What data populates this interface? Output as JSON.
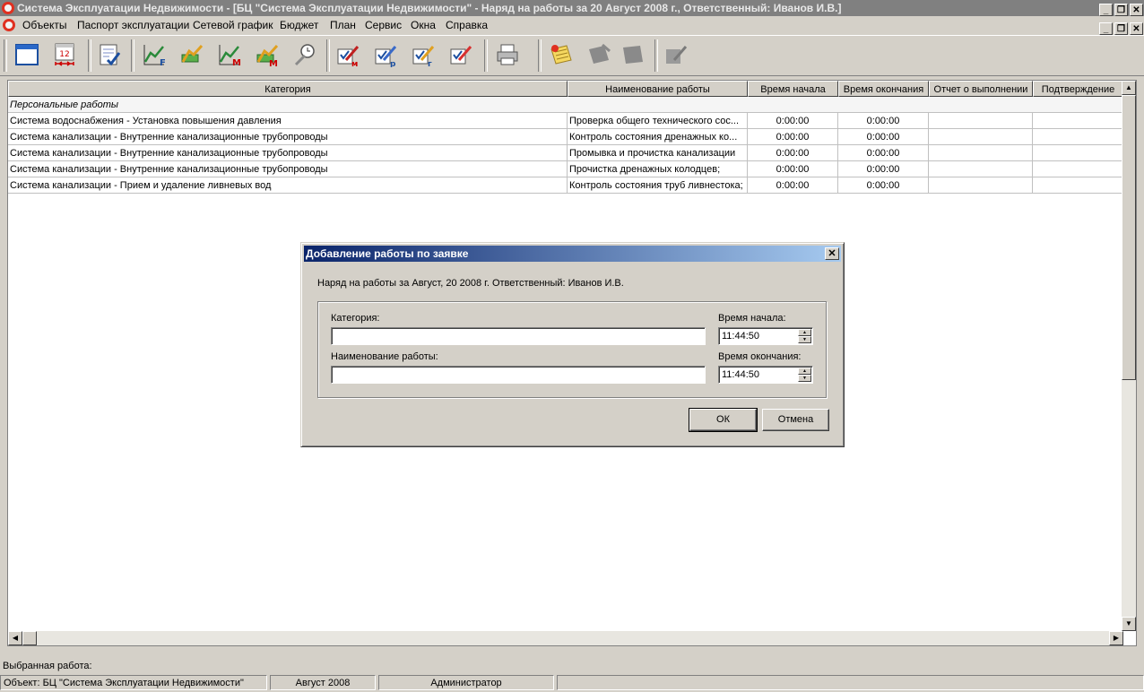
{
  "window": {
    "title": "Система Эксплуатации Недвижимости - [БЦ \"Система Эксплуатации Недвижимости\" - Наряд на работы за 20 Август 2008 г., Ответственный: Иванов И.В.]"
  },
  "menu": [
    "Объекты",
    "Паспорт эксплуатации",
    "Сетевой график",
    "Бюджет",
    "План",
    "Сервис",
    "Окна",
    "Справка"
  ],
  "toolbar": {
    "icons": [
      "window-icon",
      "calendar-icon",
      "document-check-icon",
      "chart-f-icon",
      "chart-money-icon",
      "chart-m-icon",
      "chart-money-m-icon",
      "clock-tools-icon",
      "edit-m-icon",
      "edit-p-icon",
      "edit-g-icon",
      "edit-red-icon",
      "printer-icon",
      "note-star-icon",
      "disabled-icon-1",
      "disabled-icon-2",
      "disabled-check-icon"
    ]
  },
  "grid": {
    "columns": [
      "Категория",
      "Наименование работы",
      "Время начала",
      "Время окончания",
      "Отчет о выполнении",
      "Подтверждение"
    ],
    "group_label": "Персональные работы",
    "rows": [
      {
        "category": "Система водоснабжения - Установка повышения давления",
        "work": "Проверка общего технического сос...",
        "start": "0:00:00",
        "end": "0:00:00",
        "report": "",
        "confirm": ""
      },
      {
        "category": "Система канализации - Внутренние канализационные трубопроводы",
        "work": "Контроль состояния дренажных ко...",
        "start": "0:00:00",
        "end": "0:00:00",
        "report": "",
        "confirm": ""
      },
      {
        "category": "Система канализации - Внутренние канализационные трубопроводы",
        "work": "Промывка и прочистка канализации",
        "start": "0:00:00",
        "end": "0:00:00",
        "report": "",
        "confirm": ""
      },
      {
        "category": "Система канализации - Внутренние канализационные трубопроводы",
        "work": "Прочистка дренажных колодцев;",
        "start": "0:00:00",
        "end": "0:00:00",
        "report": "",
        "confirm": ""
      },
      {
        "category": "Система канализации - Прием и удаление ливневых вод",
        "work": "Контроль состояния труб ливнестока;",
        "start": "0:00:00",
        "end": "0:00:00",
        "report": "",
        "confirm": ""
      }
    ]
  },
  "dialog": {
    "title": "Добавление работы по заявке",
    "info": "Наряд на работы за Август, 20 2008 г. Ответственный: Иванов И.В.",
    "category_label": "Категория:",
    "category_value": "",
    "work_label": "Наименование работы:",
    "work_value": "",
    "start_label": "Время начала:",
    "start_value": "11:44:50",
    "end_label": "Время окончания:",
    "end_value": "11:44:50",
    "ok_label": "ОК",
    "cancel_label": "Отмена"
  },
  "selected_work_label": "Выбранная работа:",
  "status": {
    "object": "Объект: БЦ \"Система Эксплуатации Недвижимости\"",
    "period": "Август 2008",
    "user": "Администратор",
    "extra": ""
  }
}
